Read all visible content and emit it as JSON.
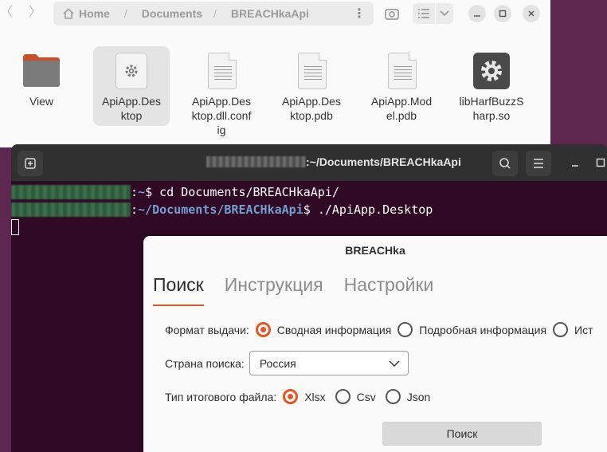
{
  "files": {
    "path": [
      "Home",
      "Documents",
      "BREACHkaApi"
    ],
    "items": [
      {
        "name": "View",
        "type": "folder"
      },
      {
        "name": "ApiApp.Desktop",
        "type": "executable",
        "selected": true
      },
      {
        "name": "ApiApp.Desktop.dll.config",
        "type": "text"
      },
      {
        "name": "ApiApp.Desktop.pdb",
        "type": "text"
      },
      {
        "name": "ApiApp.Model.pdb",
        "type": "text"
      },
      {
        "name": "libHarfBuzzSharp.so",
        "type": "library"
      }
    ],
    "labels": {
      "view": "View",
      "desktop_1": "ApiApp.Des",
      "desktop_2": "ktop",
      "config_1": "ApiApp.Des",
      "config_2": "ktop.dll.conf",
      "config_3": "ig",
      "pdb_1": "ApiApp.Des",
      "pdb_2": "ktop.pdb",
      "model_1": "ApiApp.Mod",
      "model_2": "el.pdb",
      "lib_1": "libHarfBuzzS",
      "lib_2": "harp.so"
    }
  },
  "terminal": {
    "title_suffix": ":~/Documents/BREACHkaApi",
    "line1": {
      "sep": ":",
      "path": "~",
      "prompt": "$ ",
      "command": "cd Documents/BREACHkaApi/"
    },
    "line2": {
      "sep": ":",
      "path": "~/Documents/BREACHkaApi",
      "prompt": "$ ",
      "command": "./ApiApp.Desktop"
    }
  },
  "app": {
    "title": "BREACHka",
    "tabs": [
      "Поиск",
      "Инструкция",
      "Настройки"
    ],
    "active_tab": "Поиск",
    "format_label": "Формат выдачи:",
    "format_options": [
      "Сводная информация",
      "Подробная информация",
      "Ист"
    ],
    "format_selected": "Сводная информация",
    "country_label": "Страна поиска:",
    "country_value": "Россия",
    "filetype_label": "Тип итогового файла:",
    "filetype_options": [
      "Xlsx",
      "Csv",
      "Json"
    ],
    "filetype_selected": "Xlsx",
    "search_button": "Поиск"
  },
  "colors": {
    "accent": "#e95420",
    "desktop": "#5e2750",
    "terminal_bg": "#300a24",
    "prompt_path": "#12488b"
  }
}
